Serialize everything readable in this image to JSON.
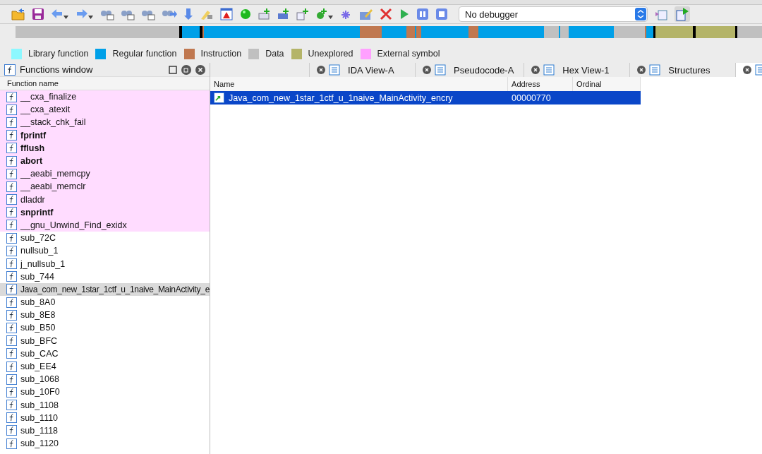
{
  "toolbar": {
    "debugger": "No debugger"
  },
  "legend": [
    {
      "label": "Library function",
      "color": "#8cf8ff"
    },
    {
      "label": "Regular function",
      "color": "#00a0e8"
    },
    {
      "label": "Instruction",
      "color": "#c07850"
    },
    {
      "label": "Data",
      "color": "#c0c0c0"
    },
    {
      "label": "Unexplored",
      "color": "#b4b468"
    },
    {
      "label": "External symbol",
      "color": "#ffa0ff"
    }
  ],
  "functions_window": {
    "title": "Functions window",
    "column": "Function name",
    "rows": [
      {
        "name": "__cxa_finalize",
        "kind": "external",
        "bold": false,
        "selected": false
      },
      {
        "name": "__cxa_atexit",
        "kind": "external",
        "bold": false,
        "selected": false
      },
      {
        "name": "__stack_chk_fail",
        "kind": "external",
        "bold": false,
        "selected": false
      },
      {
        "name": "fprintf",
        "kind": "external",
        "bold": true,
        "selected": false
      },
      {
        "name": "fflush",
        "kind": "external",
        "bold": true,
        "selected": false
      },
      {
        "name": "abort",
        "kind": "external",
        "bold": true,
        "selected": false
      },
      {
        "name": "__aeabi_memcpy",
        "kind": "external",
        "bold": false,
        "selected": false
      },
      {
        "name": "__aeabi_memclr",
        "kind": "external",
        "bold": false,
        "selected": false
      },
      {
        "name": "dladdr",
        "kind": "external",
        "bold": false,
        "selected": false
      },
      {
        "name": "snprintf",
        "kind": "external",
        "bold": true,
        "selected": false
      },
      {
        "name": "__gnu_Unwind_Find_exidx",
        "kind": "external",
        "bold": false,
        "selected": false
      },
      {
        "name": "sub_72C",
        "kind": "regular",
        "bold": false,
        "selected": false
      },
      {
        "name": "nullsub_1",
        "kind": "regular",
        "bold": false,
        "selected": false
      },
      {
        "name": "j_nullsub_1",
        "kind": "regular",
        "bold": false,
        "selected": false
      },
      {
        "name": "sub_744",
        "kind": "regular",
        "bold": false,
        "selected": false
      },
      {
        "name": "Java_com_new_1star_1ctf_u_1naive_MainActivity_e",
        "kind": "regular",
        "bold": false,
        "selected": true
      },
      {
        "name": "sub_8A0",
        "kind": "regular",
        "bold": false,
        "selected": false
      },
      {
        "name": "sub_8E8",
        "kind": "regular",
        "bold": false,
        "selected": false
      },
      {
        "name": "sub_B50",
        "kind": "regular",
        "bold": false,
        "selected": false
      },
      {
        "name": "sub_BFC",
        "kind": "regular",
        "bold": false,
        "selected": false
      },
      {
        "name": "sub_CAC",
        "kind": "regular",
        "bold": false,
        "selected": false
      },
      {
        "name": "sub_EE4",
        "kind": "regular",
        "bold": false,
        "selected": false
      },
      {
        "name": "sub_1068",
        "kind": "regular",
        "bold": false,
        "selected": false
      },
      {
        "name": "sub_10F0",
        "kind": "regular",
        "bold": false,
        "selected": false
      },
      {
        "name": "sub_1108",
        "kind": "regular",
        "bold": false,
        "selected": false
      },
      {
        "name": "sub_1110",
        "kind": "regular",
        "bold": false,
        "selected": false
      },
      {
        "name": "sub_1118",
        "kind": "regular",
        "bold": false,
        "selected": false
      },
      {
        "name": "sub_1120",
        "kind": "regular",
        "bold": false,
        "selected": false
      }
    ]
  },
  "tabs": [
    {
      "label": "IDA View-A",
      "selected": false
    },
    {
      "label": "Pseudocode-A",
      "selected": false
    },
    {
      "label": "Hex View-1",
      "selected": false
    },
    {
      "label": "Structures",
      "selected": false
    },
    {
      "selected": true
    }
  ],
  "exports": {
    "columns": [
      "Name",
      "Address",
      "Ordinal"
    ],
    "rows": [
      {
        "name": "Java_com_new_1star_1ctf_u_1naive_MainActivity_encry",
        "address": "00000770",
        "ordinal": "",
        "selected": true
      }
    ]
  }
}
